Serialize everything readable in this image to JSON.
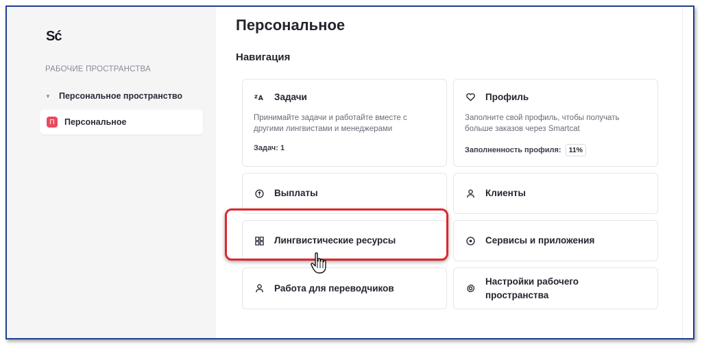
{
  "sidebar": {
    "logo": "Sć",
    "workspaces_heading": "РАБОЧИЕ ПРОСТРАНСТВА",
    "group_label": "Персональное пространство",
    "item": {
      "badge": "П",
      "label": "Персональное"
    }
  },
  "main": {
    "title": "Персональное",
    "section_title": "Навигация",
    "cards": {
      "tasks": {
        "icon": "translate-icon",
        "title": "Задачи",
        "description": "Принимайте задачи и работайте вместе с другими лингвистами и менеджерами",
        "stat": "Задач: 1"
      },
      "profile": {
        "icon": "heart-icon",
        "title": "Профиль",
        "description": "Заполните свой профиль, чтобы получать больше заказов через Smartcat",
        "stat_label": "Заполненность профиля:",
        "stat_value": "11%"
      },
      "payouts": {
        "icon": "payout-icon",
        "title": "Выплаты"
      },
      "clients": {
        "icon": "person-icon",
        "title": "Клиенты"
      },
      "linguistic_resources": {
        "icon": "grid-icon",
        "title": "Лингвистические ресурсы"
      },
      "services": {
        "icon": "target-icon",
        "title": "Сервисы и приложения"
      },
      "translator_jobs": {
        "icon": "person-icon",
        "title": "Работа для переводчиков"
      },
      "workspace_settings": {
        "icon": "gear-icon",
        "title": "Настройки рабочего пространства"
      }
    }
  },
  "colors": {
    "frame_border": "#1f3f8f",
    "highlight": "#e0262a",
    "badge": "#e84a5f",
    "sidebar_bg": "#f5f5f6"
  }
}
